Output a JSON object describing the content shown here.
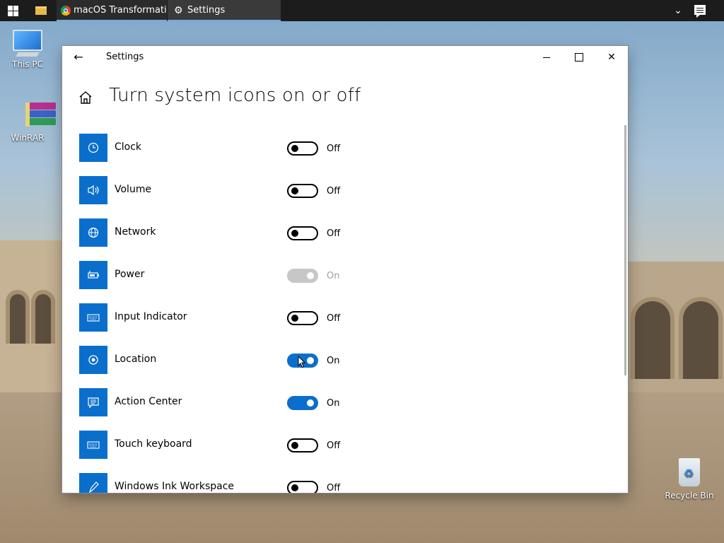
{
  "taskbar": {
    "apps": [
      {
        "label": "macOS Transformatio...",
        "icon": "chrome-icon"
      },
      {
        "label": "Settings",
        "icon": "gear-icon"
      }
    ]
  },
  "desktop": {
    "icons": [
      {
        "label": "This PC"
      },
      {
        "label": "WinRAR"
      },
      {
        "label": "Recycle Bin"
      }
    ]
  },
  "window": {
    "title": "Settings",
    "page_title": "Turn system icons on or off",
    "accent_color": "#0a6fcc",
    "items": [
      {
        "label": "Clock",
        "icon": "clock-icon",
        "state": "Off"
      },
      {
        "label": "Volume",
        "icon": "volume-icon",
        "state": "Off"
      },
      {
        "label": "Network",
        "icon": "globe-icon",
        "state": "Off"
      },
      {
        "label": "Power",
        "icon": "battery-icon",
        "state": "On"
      },
      {
        "label": "Input Indicator",
        "icon": "keyboard-icon",
        "state": "Off"
      },
      {
        "label": "Location",
        "icon": "location-icon",
        "state": "On"
      },
      {
        "label": "Action Center",
        "icon": "message-icon",
        "state": "On"
      },
      {
        "label": "Touch keyboard",
        "icon": "keyboard-icon",
        "state": "Off"
      },
      {
        "label": "Windows Ink Workspace",
        "icon": "pen-icon",
        "state": "Off"
      }
    ]
  }
}
